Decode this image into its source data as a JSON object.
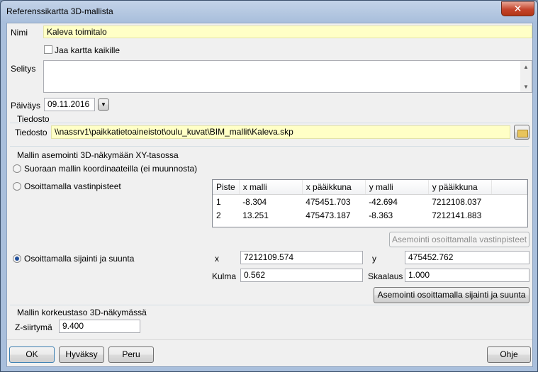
{
  "window": {
    "title": "Referenssikartta 3D-mallista",
    "close_glyph": "✕"
  },
  "name": {
    "label": "Nimi",
    "value": "Kaleva toimitalo"
  },
  "share": {
    "label": "Jaa kartta kaikille",
    "checked": false
  },
  "description": {
    "label": "Selitys",
    "value": ""
  },
  "date": {
    "label": "Päiväys",
    "value": "09.11.2016"
  },
  "file_group": {
    "title": "Tiedosto",
    "label": "Tiedosto",
    "value": "\\\\nassrv1\\paikkatietoaineistot\\oulu_kuvat\\BIM_mallit\\Kaleva.skp"
  },
  "placement": {
    "title": "Mallin asemointi 3D-näkymään XY-tasossa",
    "option_direct": "Suoraan mallin koordinaateilla (ei muunnosta)",
    "option_points": "Osoittamalla vastinpisteet",
    "option_location": "Osoittamalla sijainti ja suunta",
    "selected": "option_location",
    "points_table": {
      "headers": [
        "Piste",
        "x malli",
        "x pääikkuna",
        "y malli",
        "y pääikkuna"
      ],
      "rows": [
        [
          "1",
          "-8.304",
          "475451.703",
          "-42.694",
          "7212108.037"
        ],
        [
          "2",
          "13.251",
          "475473.187",
          "-8.363",
          "7212141.883"
        ]
      ]
    },
    "points_button": "Asemointi osoittamalla vastinpisteet",
    "x_label": "x",
    "x_value": "7212109.574",
    "y_label": "y",
    "y_value": "475452.762",
    "angle_label": "Kulma",
    "angle_value": "0.562",
    "scale_label": "Skaalaus",
    "scale_value": "1.000",
    "location_button": "Asemointi osoittamalla sijainti ja suunta"
  },
  "height_group": {
    "title": "Mallin korkeustaso 3D-näkymässä",
    "label": "Z-siirtymä",
    "value": "9.400"
  },
  "buttons": {
    "ok": "OK",
    "apply": "Hyväksy",
    "cancel": "Peru",
    "help": "Ohje"
  },
  "colors": {
    "required_field": "#ffffc6",
    "selected_radio": "#1f4e9a"
  }
}
